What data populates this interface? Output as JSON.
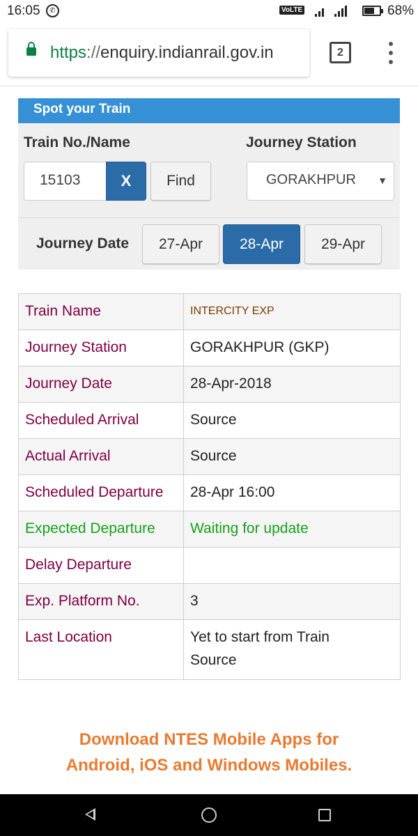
{
  "status_bar": {
    "time": "16:05",
    "network": "VoLTE",
    "battery": "68%",
    "battery_level": 0.68
  },
  "browser": {
    "url_scheme": "https",
    "url_separator": "://",
    "url_host": "enquiry.indianrail.gov.in",
    "tab_count": "2"
  },
  "spot": {
    "header": "Spot your Train",
    "train_label": "Train No./Name",
    "train_value": "15103",
    "clear_label": "X",
    "find_label": "Find",
    "station_label": "Journey Station",
    "station_value": "GORAKHPUR",
    "date_label": "Journey Date",
    "dates": [
      {
        "label": "27-Apr",
        "selected": false
      },
      {
        "label": "28-Apr",
        "selected": true
      },
      {
        "label": "29-Apr",
        "selected": false
      }
    ]
  },
  "details": {
    "rows": [
      {
        "key": "Train Name",
        "value": "INTERCITY EXP"
      },
      {
        "key": "Journey Station",
        "value": "GORAKHPUR (GKP)"
      },
      {
        "key": "Journey Date",
        "value": "28-Apr-2018"
      },
      {
        "key": "Scheduled Arrival",
        "value": "Source"
      },
      {
        "key": "Actual Arrival",
        "value": "Source"
      },
      {
        "key": "Scheduled Departure",
        "value": "28-Apr 16:00"
      },
      {
        "key": "Expected Departure",
        "value": "Waiting for update"
      },
      {
        "key": "Delay Departure",
        "value": ""
      },
      {
        "key": "Exp. Platform No.",
        "value": "3"
      },
      {
        "key": "Last Location",
        "value": "Yet to start from Train Source"
      }
    ]
  },
  "promo": {
    "line1": "Download NTES Mobile Apps for",
    "line2": "Android, iOS and Windows Mobiles."
  },
  "colors": {
    "header_blue": "#3690d6",
    "button_blue": "#2b6ba8",
    "key_maroon": "#800040",
    "status_green": "#14a01a",
    "promo_orange": "#e87a30"
  }
}
